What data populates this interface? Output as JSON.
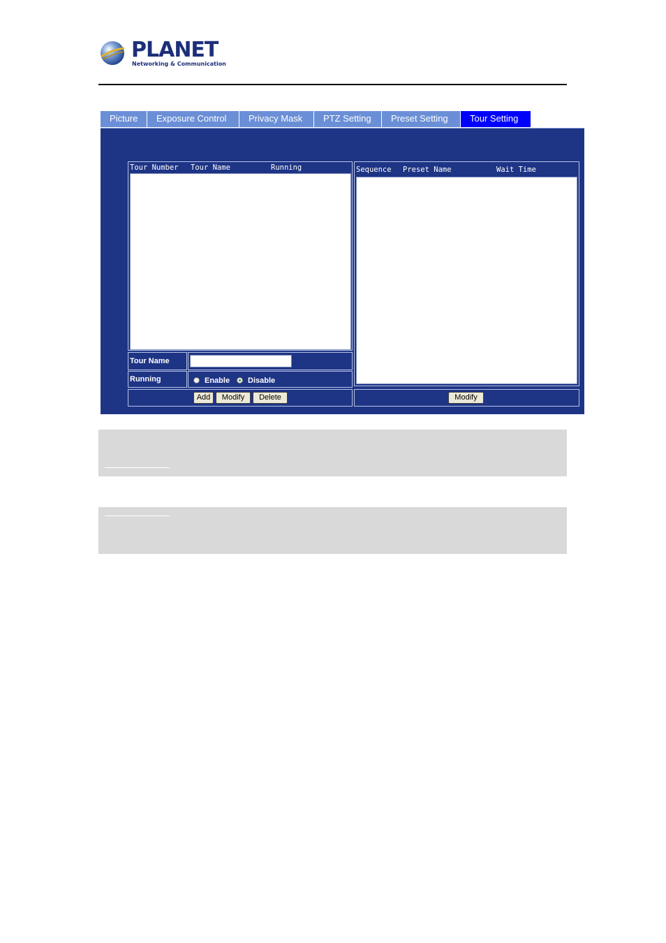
{
  "logo": {
    "brand": "PLANET",
    "tagline": "Networking & Communication"
  },
  "tabs": [
    {
      "label": "Picture",
      "active": false
    },
    {
      "label": "Exposure Control",
      "active": false
    },
    {
      "label": "Privacy Mask",
      "active": false
    },
    {
      "label": "PTZ Setting",
      "active": false
    },
    {
      "label": "Preset Setting",
      "active": false
    },
    {
      "label": "Tour Setting",
      "active": true
    }
  ],
  "tour_list": {
    "columns": [
      "Tour Number",
      "Tour Name",
      "Running"
    ],
    "rows": []
  },
  "sequence_list": {
    "columns": [
      "Sequence",
      "Preset Name",
      "Wait Time"
    ],
    "rows": []
  },
  "form": {
    "tour_name_label": "Tour Name",
    "tour_name_value": "",
    "running_label": "Running",
    "enable_label": "Enable",
    "disable_label": "Disable",
    "running_selected": "Disable"
  },
  "buttons": {
    "add": "Add",
    "modify": "Modify",
    "delete": "Delete",
    "sequence_modify": "Modify"
  },
  "colors": {
    "panel_bg": "#1e3485",
    "tab_bg": "#6b8fd6",
    "tab_active_bg": "#0000ff",
    "note_box_bg": "#d9d9d9"
  }
}
